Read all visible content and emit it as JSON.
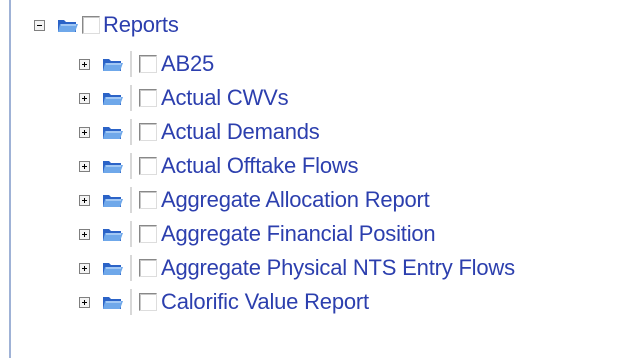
{
  "colors": {
    "link": "#2c3fae",
    "border": "#9fb2d6"
  },
  "tree": {
    "root": {
      "label": "Reports",
      "icon": "folder-open-icon",
      "expander": "collapse"
    },
    "children": [
      {
        "label": "AB25",
        "icon": "folder-icon",
        "expander": "expand"
      },
      {
        "label": "Actual CWVs",
        "icon": "folder-icon",
        "expander": "expand"
      },
      {
        "label": "Actual Demands",
        "icon": "folder-icon",
        "expander": "expand"
      },
      {
        "label": "Actual Offtake Flows",
        "icon": "folder-icon",
        "expander": "expand"
      },
      {
        "label": "Aggregate Allocation Report",
        "icon": "folder-icon",
        "expander": "expand"
      },
      {
        "label": "Aggregate Financial Position",
        "icon": "folder-icon",
        "expander": "expand"
      },
      {
        "label": "Aggregate Physical NTS Entry Flows",
        "icon": "folder-icon",
        "expander": "expand"
      },
      {
        "label": "Calorific Value Report",
        "icon": "folder-icon",
        "expander": "expand"
      }
    ]
  }
}
